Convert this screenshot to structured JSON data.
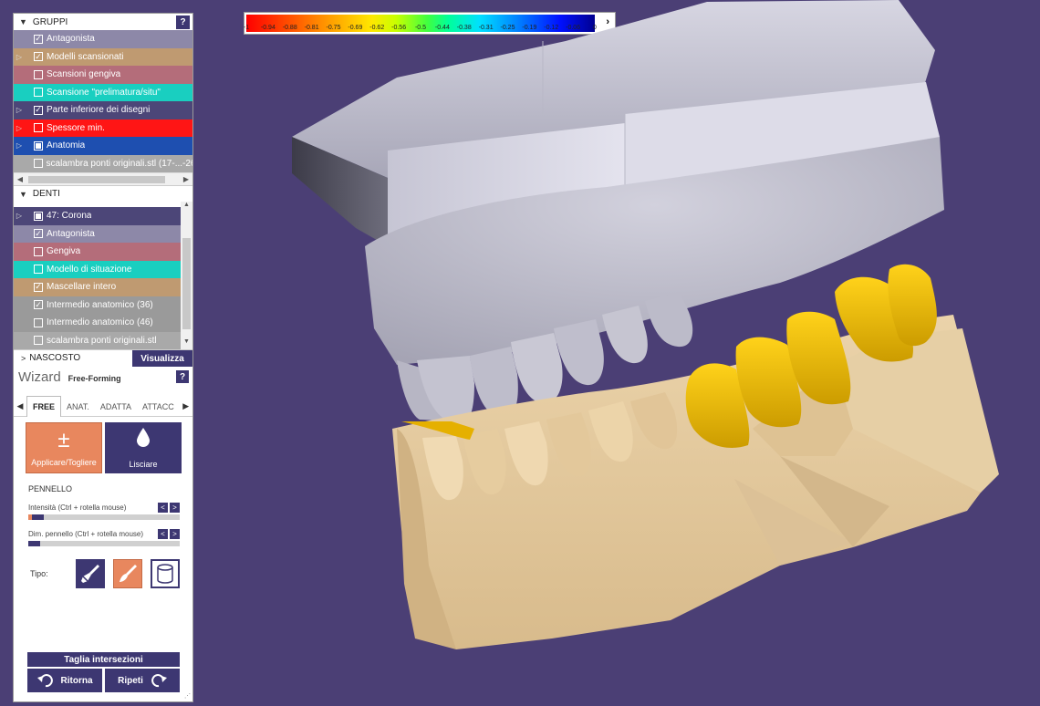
{
  "colors": {
    "background": "#4b3f75",
    "accent": "#3d3772",
    "orange": "#e8875e"
  },
  "gruppi": {
    "title": "GRUPPI",
    "help": "?",
    "items": [
      {
        "label": "Antagonista",
        "checked": "✓",
        "color": "#8d88a8",
        "expander": ""
      },
      {
        "label": "Modelli scansionati",
        "checked": "✓",
        "color": "#bf9a71",
        "expander": "▷"
      },
      {
        "label": "Scansioni gengiva",
        "checked": "",
        "color": "#b46d7a",
        "expander": ""
      },
      {
        "label": "Scansione \"prelimatura/situ\"",
        "checked": "",
        "color": "#19cfc0",
        "expander": ""
      },
      {
        "label": "Parte inferiore dei disegni",
        "checked": "✓",
        "color": "#4c4678",
        "expander": "▷"
      },
      {
        "label": "Spessore min.",
        "checked": "",
        "color": "#ff1515",
        "expander": "▷"
      },
      {
        "label": "Anatomia",
        "checked": "fill",
        "color": "#1e4fb0",
        "expander": "▷"
      },
      {
        "label": "scalambra ponti originali.stl (17-...-26)",
        "checked": "",
        "color": "#a9a9a9",
        "expander": ""
      }
    ]
  },
  "denti": {
    "title": "DENTI",
    "items": [
      {
        "label": "47: Corona",
        "checked": "fill",
        "color": "#4c4678",
        "expander": "▷"
      },
      {
        "label": "Antagonista",
        "checked": "✓",
        "color": "#8d88a8",
        "expander": ""
      },
      {
        "label": "Gengiva",
        "checked": "",
        "color": "#b46d7a",
        "expander": ""
      },
      {
        "label": "Modello di situazione",
        "checked": "",
        "color": "#19cfc0",
        "expander": ""
      },
      {
        "label": "Mascellare intero",
        "checked": "✓",
        "color": "#bf9a71",
        "expander": ""
      },
      {
        "label": "Intermedio anatomico (36)",
        "checked": "✓",
        "color": "#9a9a9a",
        "expander": ""
      },
      {
        "label": "Intermedio anatomico (46)",
        "checked": "",
        "color": "#9a9a9a",
        "expander": ""
      },
      {
        "label": "scalambra ponti originali.stl",
        "checked": "",
        "color": "#a9a9a9",
        "expander": ""
      }
    ]
  },
  "nascosto": {
    "label": "NASCOSTO",
    "visualizza": "Visualizza"
  },
  "wizard": {
    "title": "Wizard",
    "subtitle": "Free-Forming",
    "help": "?",
    "tabs": [
      "FREE",
      "ANAT.",
      "ADATTA",
      "ATTACC"
    ],
    "tools": {
      "apply": "Applicare/Togliere",
      "smooth": "Lisciare"
    },
    "brush_heading": "PENNELLO",
    "intensity_label": "Intensità (Ctrl + rotella mouse)",
    "intensity_value": 0.1,
    "size_label": "Dim. pennello (Ctrl + rotella mouse)",
    "size_value": 0.08,
    "tipo_label": "Tipo:",
    "cut_label": "Taglia intersezioni",
    "undo_label": "Ritorna",
    "redo_label": "Ripeti"
  },
  "scale": {
    "ticks": [
      "-1",
      "-0.94",
      "-0.88",
      "-0.81",
      "-0.75",
      "-0.69",
      "-0.62",
      "-0.56",
      "-0.5",
      "-0.44",
      "-0.38",
      "-0.31",
      "-0.25",
      "-0.19",
      "-0.12",
      "-0.06",
      "0"
    ]
  }
}
